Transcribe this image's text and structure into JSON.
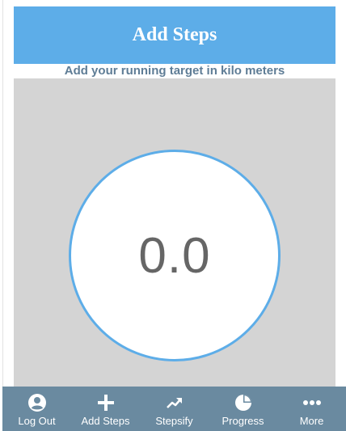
{
  "header": {
    "title": "Add Steps"
  },
  "subtitle": "Add your running target in kilo meters",
  "dial": {
    "value": "0.0"
  },
  "tabs": [
    {
      "label": "Log Out",
      "icon": "user-icon"
    },
    {
      "label": "Add Steps",
      "icon": "plus-icon"
    },
    {
      "label": "Stepsify",
      "icon": "trending-up-icon"
    },
    {
      "label": "Progress",
      "icon": "pie-chart-icon"
    },
    {
      "label": "More",
      "icon": "more-icon"
    }
  ],
  "colors": {
    "accent": "#5dade8",
    "tabbar": "#6a8aa0",
    "panel": "#d4d4d4",
    "subtitle": "#5f7d96"
  }
}
